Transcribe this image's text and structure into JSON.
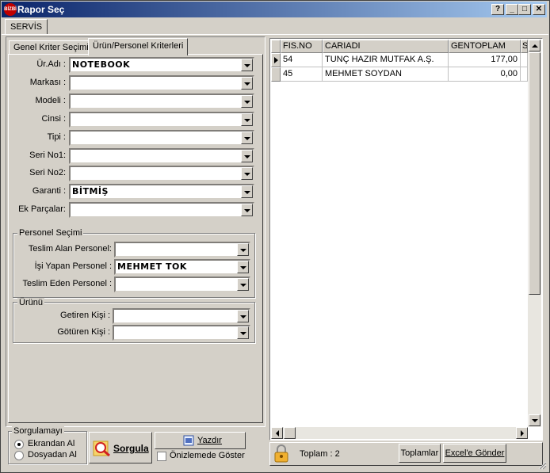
{
  "window": {
    "title": "Rapor Seç",
    "icon": "app-logo-icon",
    "app_icon_text": "BİZBİ",
    "help": "?",
    "minimize": "_",
    "maximize": "□",
    "close": "✕"
  },
  "top_tab": "SERVİS",
  "subtabs": [
    "Genel Kriter Seçimi",
    "Ürün/Personel Kriterleri"
  ],
  "product_filters": [
    {
      "label": "Ür.Adı :",
      "value": "NOTEBOOK"
    },
    {
      "label": "Markası :",
      "value": ""
    },
    {
      "label": "Modeli :",
      "value": ""
    },
    {
      "label": "Cinsi :",
      "value": ""
    },
    {
      "label": "Tipi :",
      "value": ""
    },
    {
      "label": "Seri No1:",
      "value": ""
    },
    {
      "label": "Seri No2:",
      "value": ""
    },
    {
      "label": "Garanti :",
      "value": "BİTMİŞ"
    },
    {
      "label": "Ek Parçalar:",
      "value": ""
    }
  ],
  "personnel_group": {
    "title": "Personel Seçimi",
    "fields": [
      {
        "label": "Teslim Alan Personel:",
        "value": ""
      },
      {
        "label": "İşi Yapan Personel :",
        "value": "MEHMET TOK"
      },
      {
        "label": "Teslim Eden Personel :",
        "value": ""
      }
    ]
  },
  "product_group": {
    "title": "Ürünü",
    "fields": [
      {
        "label": "Getiren Kişi :",
        "value": ""
      },
      {
        "label": "Götüren Kişi :",
        "value": ""
      }
    ]
  },
  "query_group": {
    "title": "Sorgulamayı",
    "options": [
      "Ekrandan Al",
      "Dosyadan Al"
    ],
    "selected": "Ekrandan Al"
  },
  "buttons": {
    "query": "Sorgula",
    "print": "Yazdır",
    "preview": "Önizlemede Göster",
    "totals": "Toplamlar",
    "excel": "Excel'e Gönder"
  },
  "grid": {
    "columns": [
      "FIS.NO",
      "CARIADI",
      "GENTOPLAM",
      "S"
    ],
    "rows": [
      {
        "fis_no": "54",
        "cari_adi": "TUNÇ HAZIR MUTFAK A.Ş.",
        "gen_toplam": "177,00",
        "s": ""
      },
      {
        "fis_no": "45",
        "cari_adi": "MEHMET SOYDAN",
        "gen_toplam": "0,00",
        "s": ""
      }
    ]
  },
  "footer": {
    "total_label": "Toplam : 2"
  }
}
